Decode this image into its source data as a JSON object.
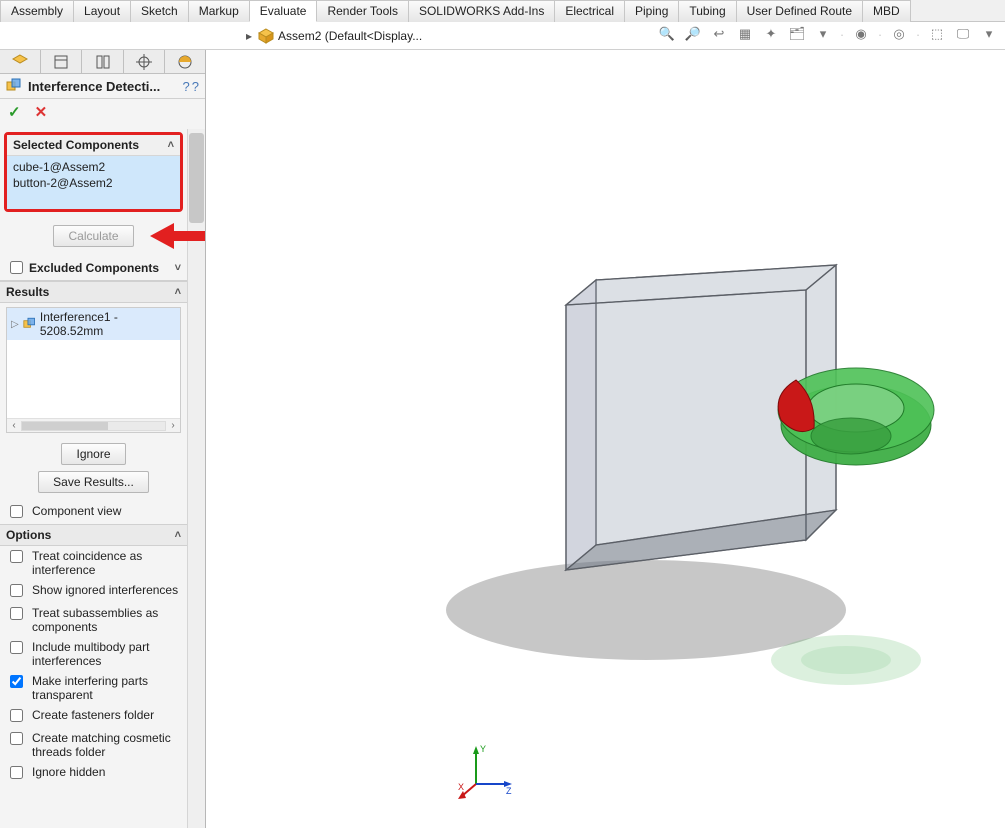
{
  "ribbon": {
    "tabs": [
      "Assembly",
      "Layout",
      "Sketch",
      "Markup",
      "Evaluate",
      "Render Tools",
      "SOLIDWORKS Add-Ins",
      "Electrical",
      "Piping",
      "Tubing",
      "User Defined Route",
      "MBD"
    ],
    "active": "Evaluate"
  },
  "document": {
    "name": "Assem2",
    "display": "(Default<Display..."
  },
  "panel": {
    "title": "Interference Detecti...",
    "ok_glyph": "✓",
    "cancel_glyph": "✕",
    "help_glyph": "?",
    "pin_glyph": "?"
  },
  "selected_components": {
    "heading": "Selected Components",
    "items": [
      "cube-1@Assem2",
      "button-2@Assem2"
    ],
    "calculate_label": "Calculate"
  },
  "excluded": {
    "label": "Excluded Components"
  },
  "results": {
    "heading": "Results",
    "items": [
      "Interference1 - 5208.52mm"
    ],
    "ignore_label": "Ignore",
    "save_label": "Save Results...",
    "component_view_label": "Component view"
  },
  "options": {
    "heading": "Options",
    "items": [
      {
        "label": "Treat coincidence as interference",
        "checked": false
      },
      {
        "label": "Show ignored interferences",
        "checked": false
      },
      {
        "label": "Treat subassemblies as components",
        "checked": false
      },
      {
        "label": "Include multibody part interferences",
        "checked": false
      },
      {
        "label": "Make interfering parts transparent",
        "checked": true
      },
      {
        "label": "Create fasteners folder",
        "checked": false
      },
      {
        "label": "Create matching cosmetic threads folder",
        "checked": false
      },
      {
        "label": "Ignore hidden",
        "checked": false
      }
    ]
  },
  "triad": {
    "x": "X",
    "y": "Y",
    "z": "Z"
  }
}
